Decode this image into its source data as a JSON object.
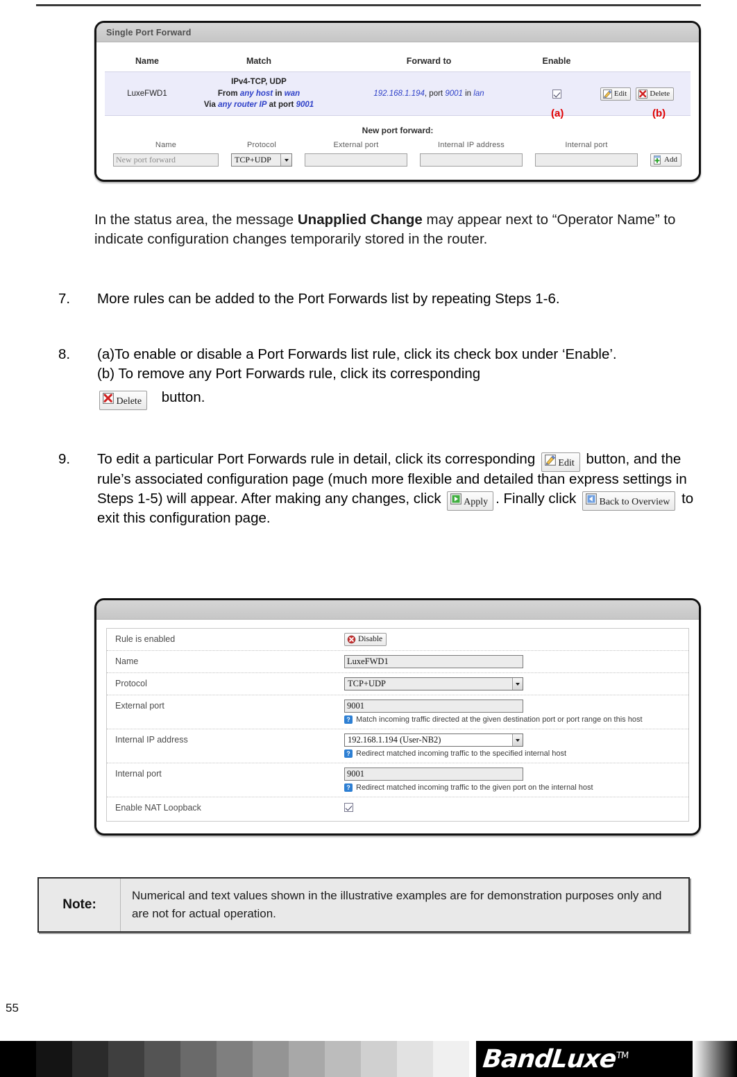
{
  "page_number": "55",
  "overview_panel": {
    "title": "Single Port Forward",
    "table": {
      "headers": [
        "Name",
        "Match",
        "Forward to",
        "Enable",
        ""
      ],
      "rows": [
        {
          "name": "LuxeFWD1",
          "match_line1": "IPv4-TCP, UDP",
          "match_from_prefix": "From",
          "match_from_host": "any host",
          "match_from_in": "in",
          "match_from_zone": "wan",
          "match_via_prefix": "Via",
          "match_via_router": "any router IP",
          "match_via_at": "at port",
          "match_via_port": "9001",
          "forward_ip": "192.168.1.194",
          "forward_port_label": ", port",
          "forward_port": "9001",
          "forward_in": "in",
          "forward_zone": "lan",
          "enabled": true,
          "edit_label": "Edit",
          "delete_label": "Delete"
        }
      ]
    },
    "callout_a": "(a)",
    "callout_b": "(b)",
    "new_forward": {
      "title": "New port forward:",
      "labels": {
        "name": "Name",
        "protocol": "Protocol",
        "external_port": "External port",
        "internal_ip": "Internal IP address",
        "internal_port": "Internal port"
      },
      "name_placeholder": "New port forward",
      "name_value": "",
      "protocol_value": "TCP+UDP",
      "external_port_value": "",
      "internal_ip_value": "",
      "internal_port_value": "",
      "add_label": "Add"
    }
  },
  "body": {
    "intro": {
      "part1": "In the status area, the message ",
      "bold": "Unapplied Change",
      "part2": " may appear next to “Operator Name” to indicate configuration changes temporarily stored in the router."
    },
    "step7": {
      "number": "7.",
      "text": "More rules can be added to the Port Forwards list by repeating Steps 1-6."
    },
    "step8": {
      "number": "8.",
      "line_a": "(a)To enable or disable a Port Forwards list rule, click its check box under ‘Enable’.",
      "line_b": "(b) To remove any Port Forwards rule, click its corresponding",
      "delete_label": "Delete",
      "after_delete": "button."
    },
    "step9": {
      "number": "9.",
      "t1": "To edit a particular Port Forwards rule in detail, click its corresponding",
      "edit_label": "Edit",
      "t2": "button, and the rule’s associated configuration page (much more flexible and detailed than express settings in Steps 1-5) will appear. After making any changes, click",
      "apply_label": "Apply",
      "t3": ". Finally click",
      "back_label": "Back to Overview",
      "t4": "to exit this configuration page."
    }
  },
  "detail_panel": {
    "title": "",
    "rows": [
      {
        "label": "Rule is enabled",
        "type": "button",
        "button_label": "Disable",
        "hint": ""
      },
      {
        "label": "Name",
        "type": "text",
        "value": "LuxeFWD1",
        "hint": ""
      },
      {
        "label": "Protocol",
        "type": "select",
        "value": "TCP+UDP",
        "hint": ""
      },
      {
        "label": "External port",
        "type": "text",
        "value": "9001",
        "hint": "Match incoming traffic directed at the given destination port or port range on this host"
      },
      {
        "label": "Internal IP address",
        "type": "select",
        "value": "192.168.1.194 (User-NB2)",
        "hint": "Redirect matched incoming traffic to the specified internal host"
      },
      {
        "label": "Internal port",
        "type": "text",
        "value": "9001",
        "hint": "Redirect matched incoming traffic to the given port on the internal host"
      },
      {
        "label": "Enable NAT Loopback",
        "type": "checkbox",
        "checked": true,
        "hint": ""
      }
    ]
  },
  "note": {
    "label": "Note:",
    "text": "Numerical and text values shown in the illustrative examples are for demonstration purposes only and are not for actual operation."
  },
  "footer": {
    "brand": "BandLuxe",
    "tm": "TM"
  },
  "colors": {
    "accent_blue": "#2f41c8",
    "callout_red": "#e00000",
    "panel_header": "#cccccc"
  }
}
